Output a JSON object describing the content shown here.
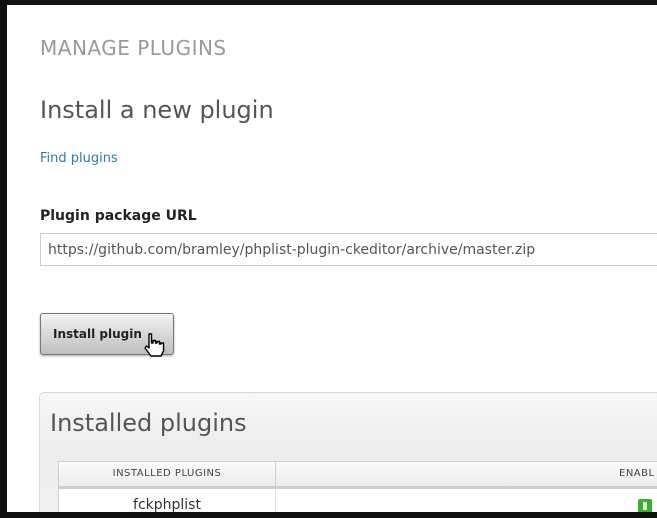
{
  "page": {
    "title": "MANAGE PLUGINS"
  },
  "install": {
    "heading": "Install a new plugin",
    "find_link": "Find plugins",
    "url_label": "Plugin package URL",
    "url_value": "https://github.com/bramley/phplist-plugin-ckeditor/archive/master.zip",
    "button_label": "Install plugin"
  },
  "installed": {
    "heading": "Installed plugins",
    "columns": [
      "INSTALLED PLUGINS",
      "ENABL"
    ],
    "rows": [
      {
        "name": "fckphplist",
        "enabled_icon": "enabled-icon"
      }
    ]
  },
  "colors": {
    "link": "#2a7ea8",
    "enabled": "#3cae2f"
  }
}
